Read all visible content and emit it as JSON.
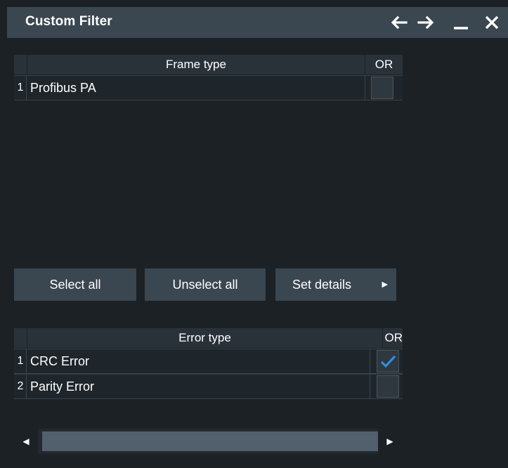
{
  "window": {
    "title": "Custom Filter",
    "icons": [
      "arrow-left-icon",
      "arrow-right-icon",
      "minimize-icon",
      "close-icon"
    ]
  },
  "frame_table": {
    "header_name": "Frame type",
    "header_or": "OR",
    "rows": [
      {
        "index": "1",
        "name": "Profibus PA",
        "or_checked": false
      }
    ]
  },
  "buttons": {
    "select_all": "Select all",
    "unselect_all": "Unselect all",
    "set_details": "Set details"
  },
  "error_table": {
    "header_name": "Error type",
    "header_or": "OR",
    "rows": [
      {
        "index": "1",
        "name": "CRC Error",
        "or_checked": true
      },
      {
        "index": "2",
        "name": "Parity Error",
        "or_checked": false
      }
    ]
  },
  "colors": {
    "titlebar": "#3a4650",
    "background": "#1b2125",
    "check_accent": "#2f8de4"
  }
}
